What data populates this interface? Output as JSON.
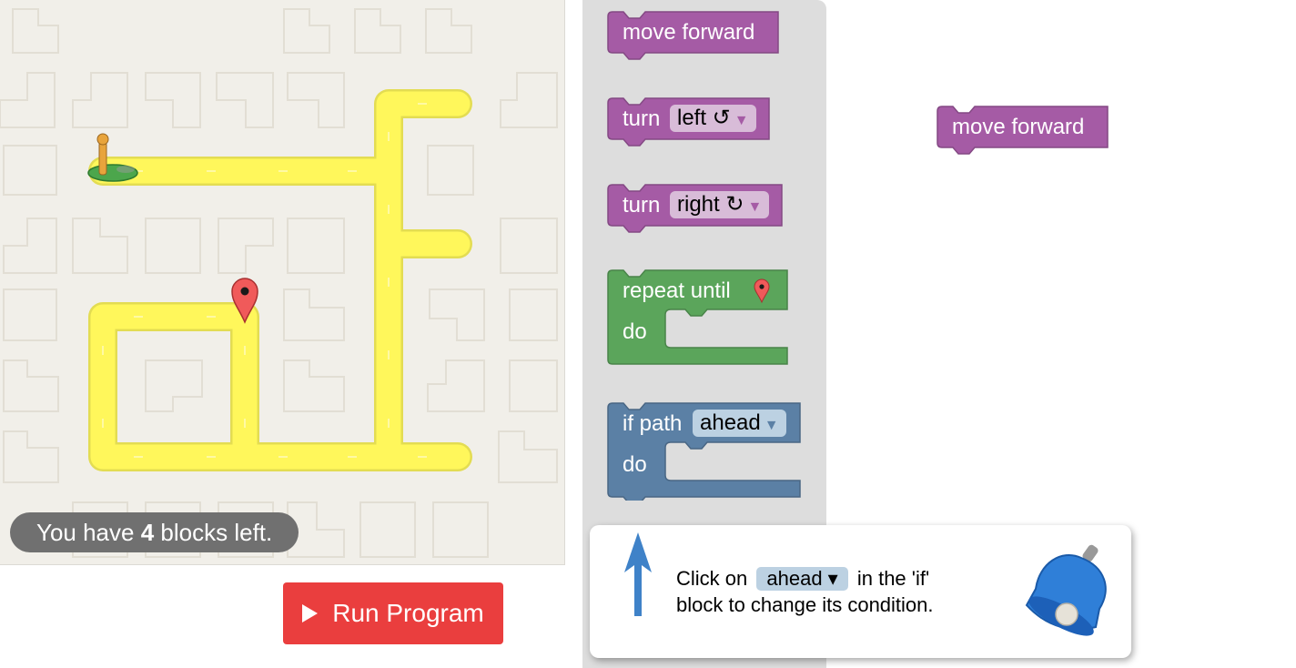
{
  "maze": {
    "capacity": {
      "prefix": "You have",
      "count": "4",
      "suffix": "blocks left."
    },
    "colors": {
      "path": "#fff75b",
      "background": "#f1efe9"
    }
  },
  "run_button": {
    "label": "Run Program"
  },
  "toolbox": {
    "move_forward": "move forward",
    "turn_left": {
      "label": "turn",
      "dropdown": "left ↺"
    },
    "turn_right": {
      "label": "turn",
      "dropdown": "right ↻"
    },
    "repeat_until": {
      "label": "repeat until",
      "do": "do"
    },
    "if_path": {
      "label": "if path",
      "dropdown": "ahead",
      "do": "do"
    }
  },
  "workspace": {
    "move_forward": "move forward"
  },
  "hint": {
    "line_before": "Click on",
    "chip": "ahead ▾",
    "line_after": "in the 'if'",
    "line2": "block to change its condition."
  },
  "colors": {
    "motion_block": "#a55ba5",
    "loop_block": "#5ba55b",
    "logic_block": "#5b80a5",
    "run_button": "#ea3e3e"
  }
}
